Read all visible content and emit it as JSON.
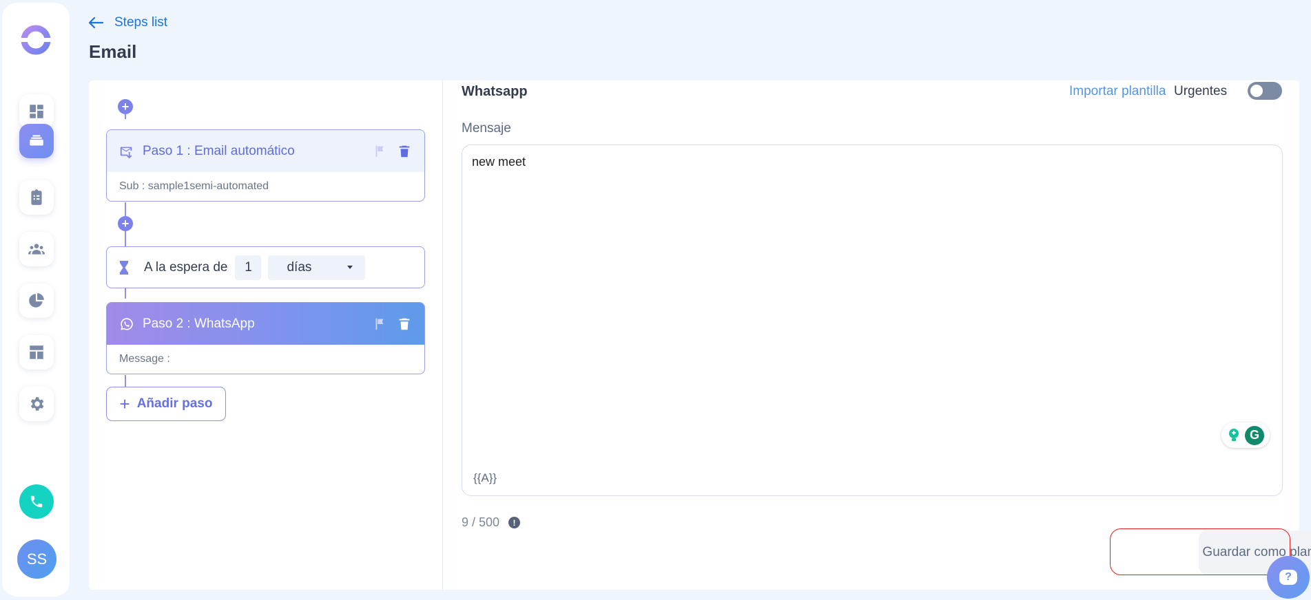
{
  "header": {
    "back_label": "Steps list",
    "title": "Email"
  },
  "sidebar": {
    "items": [
      {
        "icon": "dashboard-icon"
      },
      {
        "icon": "layers-icon",
        "active": true
      },
      {
        "icon": "clipboard-icon"
      },
      {
        "icon": "people-icon"
      },
      {
        "icon": "pie-chart-icon"
      },
      {
        "icon": "layout-icon"
      },
      {
        "icon": "gear-icon"
      }
    ],
    "phone_icon": "phone-icon",
    "avatar_initials": "SS"
  },
  "steps": [
    {
      "title": "Paso 1 : Email automático",
      "subtitle": "Sub : sample1semi-automated",
      "icon": "email-auto-icon"
    },
    {
      "title": "Paso 2 : WhatsApp",
      "subtitle": "Message :",
      "icon": "whatsapp-icon"
    }
  ],
  "wait": {
    "label": "A la espera de",
    "value": "1",
    "unit": "días"
  },
  "add_step_label": "Añadir paso",
  "editor": {
    "section_title": "Whatsapp",
    "import_label": "Importar plantilla",
    "urgent_label": "Urgentes",
    "urgent_on": false,
    "message_label": "Mensaje",
    "message_value": "new meet",
    "variable_tag": "{{A}}",
    "counter": "9 / 500",
    "save_label": "Guardar como plantilla"
  },
  "colors": {
    "accent": "#7d81ea",
    "link": "#1d73d8",
    "highlight": "#e02020"
  }
}
